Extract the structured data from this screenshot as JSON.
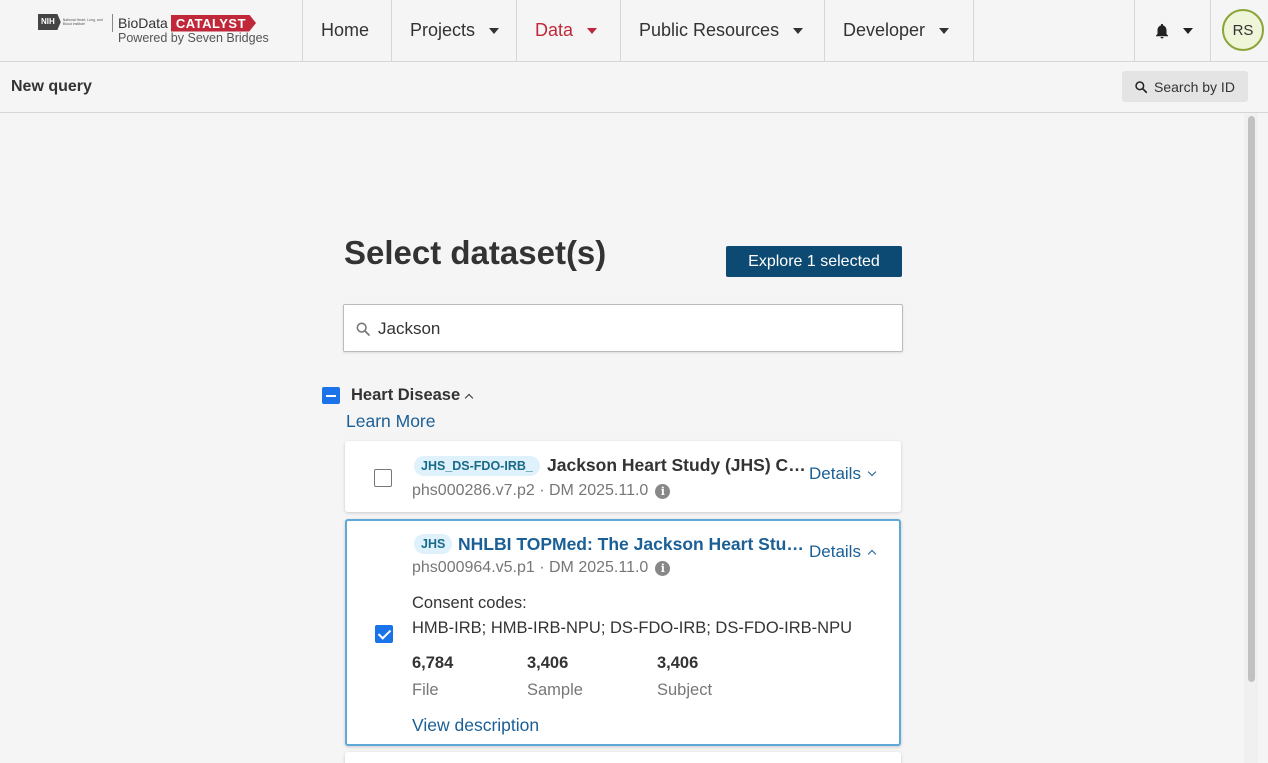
{
  "header": {
    "nih_label": "NIH",
    "nih_institute": "National Heart, Lung, and Blood Institute",
    "brand_bio": "BioData",
    "brand_catalyst": "CATALYST",
    "powered_by": "Powered by Seven Bridges",
    "nav": [
      {
        "label": "Home"
      },
      {
        "label": "Projects"
      },
      {
        "label": "Data"
      },
      {
        "label": "Public Resources"
      },
      {
        "label": "Developer"
      }
    ],
    "avatar_initials": "RS"
  },
  "subbar": {
    "title": "New query",
    "search_by_id": "Search by ID"
  },
  "main": {
    "heading": "Select dataset(s)",
    "explore_button": "Explore 1 selected",
    "search_value": "Jackson",
    "group": {
      "title": "Heart Disease",
      "learn_more": "Learn More"
    },
    "datasets": [
      {
        "tag": "JHS_DS-FDO-IRB_",
        "title": "Jackson Heart Study (JHS) Co…",
        "meta": "phs000286.v7.p2 · DM 2025.11.0",
        "details": "Details",
        "checked": false
      },
      {
        "tag": "JHS",
        "title": "NHLBI TOPMed: The Jackson Heart Stu…",
        "meta": "phs000964.v5.p1 · DM 2025.11.0",
        "details": "Details",
        "checked": true,
        "consent_label": "Consent codes:",
        "consent_codes": "HMB-IRB; HMB-IRB-NPU; DS-FDO-IRB; DS-FDO-IRB-NPU",
        "stats": [
          {
            "value": "6,784",
            "label": "File"
          },
          {
            "value": "3,406",
            "label": "Sample"
          },
          {
            "value": "3,406",
            "label": "Subject"
          }
        ],
        "view_description": "View description"
      }
    ]
  },
  "colors": {
    "brand_red": "#c0283a",
    "primary_button": "#0d4a73",
    "link": "#1a5f96",
    "selected_border": "#5fa8d8",
    "checkbox": "#1a73e8"
  },
  "icons": {
    "search": "search-icon",
    "bell": "bell-icon",
    "info": "info-icon"
  }
}
